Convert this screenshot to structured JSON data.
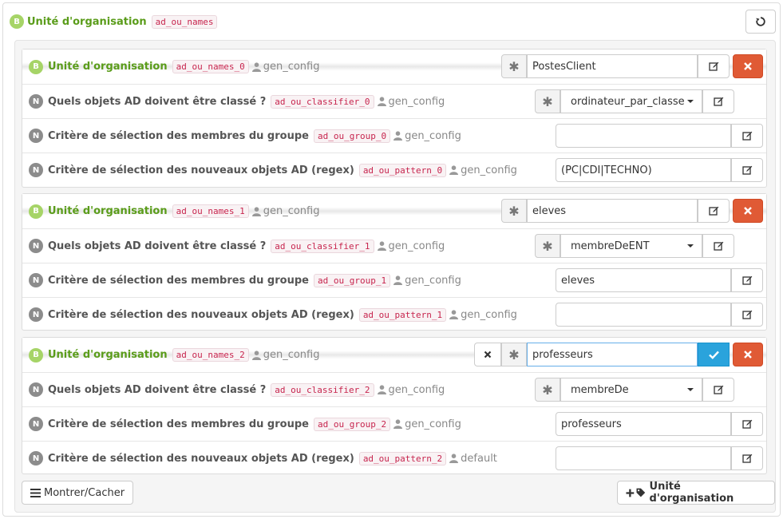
{
  "header": {
    "badge": "B",
    "title": "Unité d'organisation",
    "var": "ad_ou_names"
  },
  "badges": {
    "b": "B",
    "n": "N"
  },
  "groups": [
    {
      "head": {
        "label": "Unité d'organisation",
        "var": "ad_ou_names_0",
        "source": "gen_config",
        "value": "PostesClient"
      },
      "classifier": {
        "label": "Quels objets AD doivent être classé ?",
        "var": "ad_ou_classifier_0",
        "source": "gen_config",
        "value": "ordinateur_par_classe"
      },
      "group": {
        "label": "Critère de sélection des membres du groupe",
        "var": "ad_ou_group_0",
        "source": "gen_config",
        "value": ""
      },
      "pattern": {
        "label": "Critère de sélection des nouveaux objets AD (regex)",
        "var": "ad_ou_pattern_0",
        "source": "gen_config",
        "value": "(PC|CDI|TECHNO)"
      }
    },
    {
      "head": {
        "label": "Unité d'organisation",
        "var": "ad_ou_names_1",
        "source": "gen_config",
        "value": "eleves"
      },
      "classifier": {
        "label": "Quels objets AD doivent être classé ?",
        "var": "ad_ou_classifier_1",
        "source": "gen_config",
        "value": "membreDeENT"
      },
      "group": {
        "label": "Critère de sélection des membres du groupe",
        "var": "ad_ou_group_1",
        "source": "gen_config",
        "value": "eleves"
      },
      "pattern": {
        "label": "Critère de sélection des nouveaux objets AD (regex)",
        "var": "ad_ou_pattern_1",
        "source": "gen_config",
        "value": ""
      }
    },
    {
      "head": {
        "label": "Unité d'organisation",
        "var": "ad_ou_names_2",
        "source": "gen_config",
        "value": "professeurs"
      },
      "classifier": {
        "label": "Quels objets AD doivent être classé ?",
        "var": "ad_ou_classifier_2",
        "source": "gen_config",
        "value": "membreDe"
      },
      "group": {
        "label": "Critère de sélection des membres du groupe",
        "var": "ad_ou_group_2",
        "source": "gen_config",
        "value": "professeurs"
      },
      "pattern": {
        "label": "Critère de sélection des nouveaux objets AD (regex)",
        "var": "ad_ou_pattern_2",
        "source": "default",
        "value": ""
      }
    }
  ],
  "footer": {
    "toggle_label": "Montrer/Cacher",
    "add_label": "Unité d'organisation"
  },
  "colors": {
    "green": "#5a9c1a",
    "badge_b": "#a6d467",
    "badge_n": "#8c8c8c",
    "danger": "#e05a35",
    "primary": "#2aa3dc"
  },
  "icons": [
    "reset-icon",
    "user-icon",
    "asterisk-icon",
    "edit-icon",
    "remove-icon",
    "check-icon",
    "cancel-icon",
    "bars-icon",
    "plus-icon",
    "tag-icon",
    "caret-down-icon"
  ]
}
